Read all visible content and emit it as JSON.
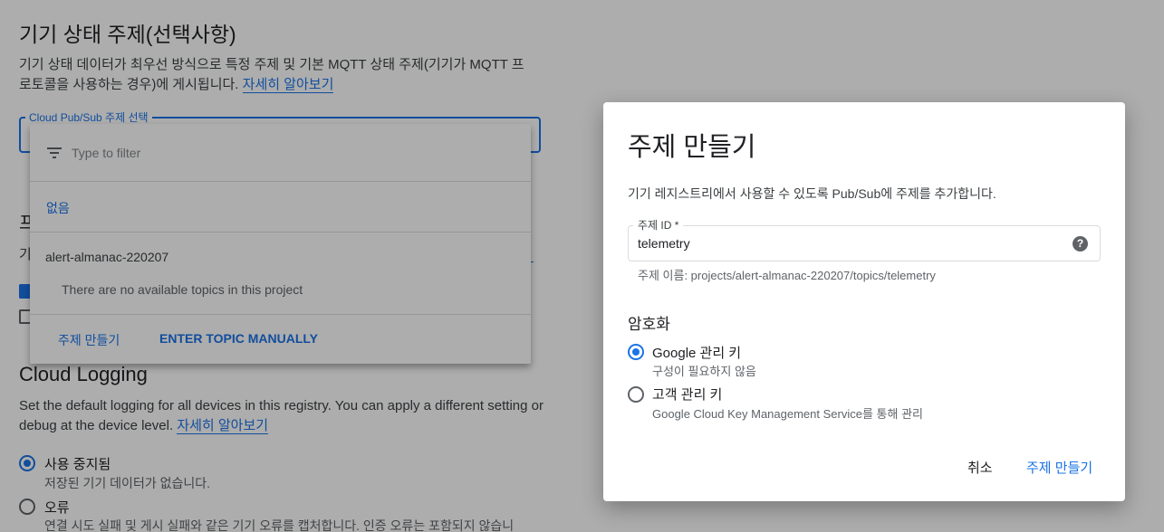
{
  "background": {
    "state_topic_heading": "기기 상태 주제(선택사항)",
    "state_topic_desc_line1": "기기 상태 데이터가 최우선 방식으로 특정 주제 및 기본 MQTT 상태 주제(기기가 MQTT 프",
    "state_topic_desc_line2": "로토콜을 사용하는 경우)에 게시됩니다.",
    "learn_more": "자세히 알아보기",
    "select_label": "Cloud Pub/Sub 주제 선택",
    "partial_heading": "프",
    "partial_text": "기",
    "logging_heading": "Cloud Logging",
    "logging_desc_line1": "Set the default logging for all devices in this registry. You can apply a different setting or",
    "logging_desc_line2": "debug at the device level.",
    "logging_learn_more": "자세히 알아보기",
    "logging_options": [
      {
        "label": "사용 중지됨",
        "sub": "저장된 기기 데이터가 없습니다.",
        "selected": true
      },
      {
        "label": "오류",
        "sub": "연결 시도 실패 및 게시 실패와 같은 기기 오류를 캡처합니다. 인증 오류는 포함되지 않습니",
        "selected": false
      }
    ]
  },
  "dropdown": {
    "filter_placeholder": "Type to filter",
    "none_option": "없음",
    "project_name": "alert-almanac-220207",
    "empty_message": "There are no available topics in this project",
    "create_topic": "주제 만들기",
    "enter_manually": "ENTER TOPIC MANUALLY"
  },
  "dialog": {
    "title": "주제 만들기",
    "description": "기기 레지스트리에서 사용할 수 있도록 Pub/Sub에 주제를 추가합니다.",
    "topic_id_label": "주제 ID *",
    "topic_id_value": "telemetry",
    "topic_hint": "주제 이름: projects/alert-almanac-220207/topics/telemetry",
    "help_icon_glyph": "?",
    "encryption_heading": "암호화",
    "encryption_options": [
      {
        "label": "Google 관리 키",
        "sub": "구성이 필요하지 않음",
        "selected": true
      },
      {
        "label": "고객 관리 키",
        "sub": "Google Cloud Key Management Service를 통해 관리",
        "selected": false
      }
    ],
    "cancel": "취소",
    "create": "주제 만들기"
  },
  "colors": {
    "accent": "#1a73e8",
    "scrim": "rgba(0,0,0,0.32)"
  }
}
